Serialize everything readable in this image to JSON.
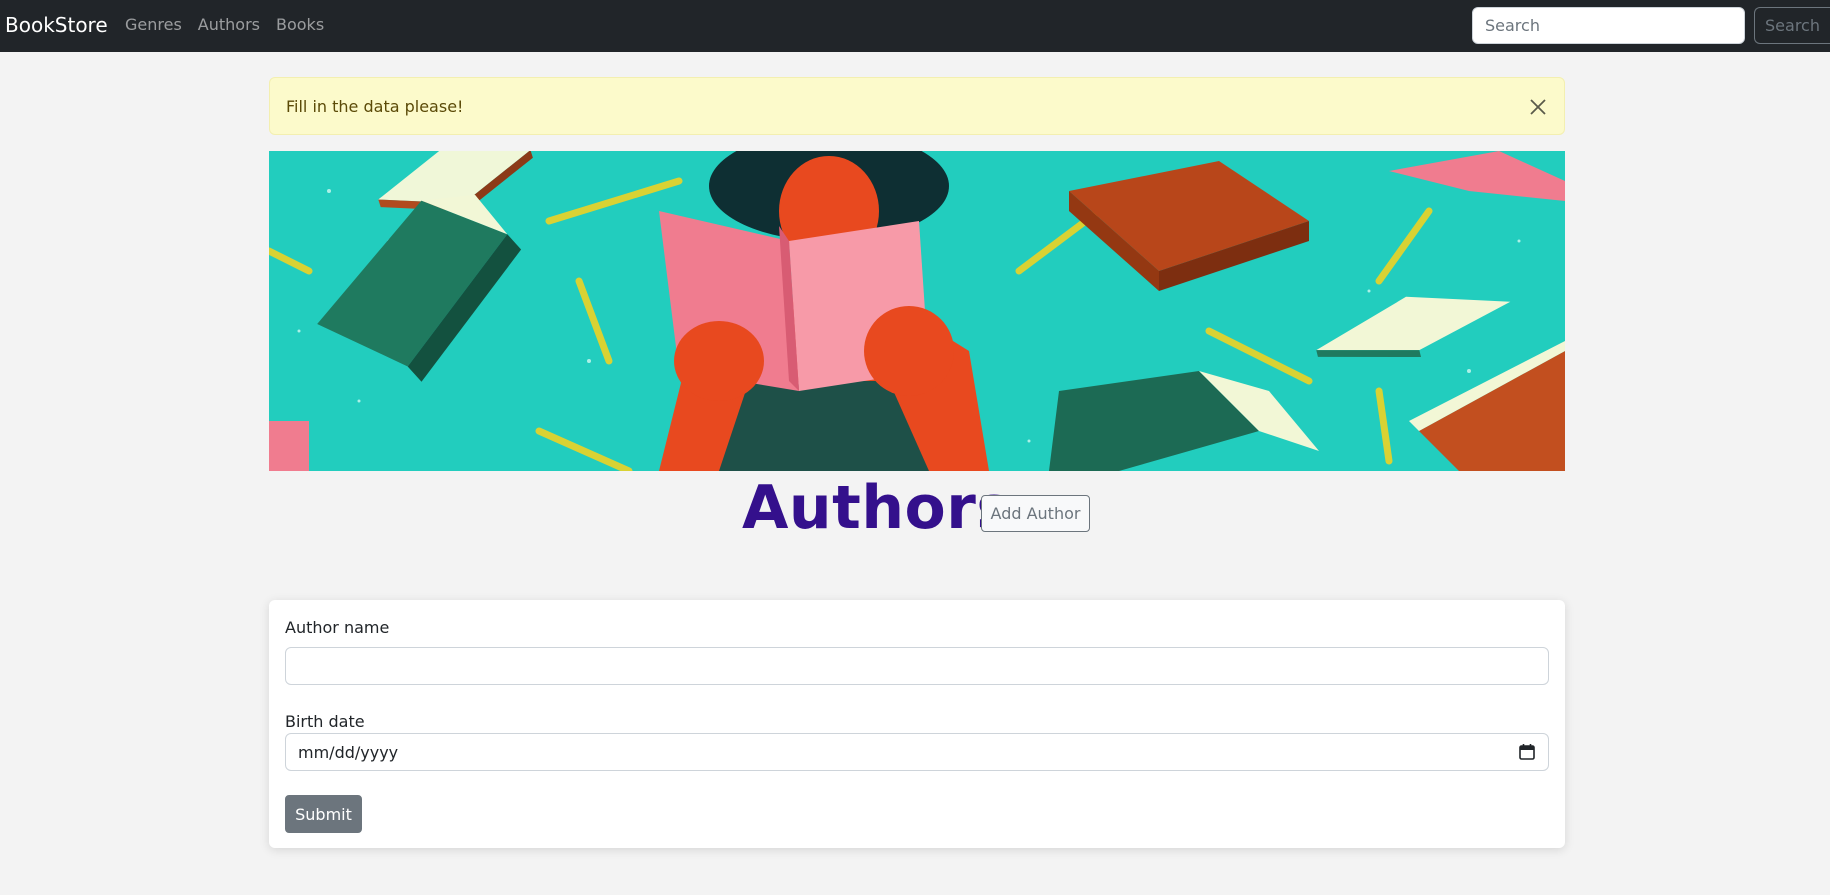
{
  "navbar": {
    "brand": "BookStore",
    "links": [
      "Genres",
      "Authors",
      "Books"
    ],
    "search_placeholder": "Search",
    "search_button": "Search"
  },
  "alert": {
    "message": "Fill in the data please!"
  },
  "page": {
    "title": "Authors",
    "add_button": "Add Author"
  },
  "form": {
    "name_label": "Author name",
    "name_value": "",
    "birth_label": "Birth date",
    "birth_placeholder": "mm/dd/yyyy",
    "submit_label": "Submit"
  },
  "colors": {
    "navbar_bg": "#212529",
    "alert_bg": "#fcfacb",
    "title": "#34108c",
    "banner_bg": "#20cdbd",
    "submit_bg": "#6c757d"
  }
}
